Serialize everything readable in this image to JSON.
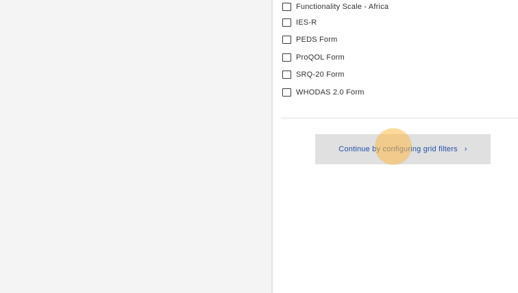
{
  "forms": {
    "items": [
      {
        "label": "Functionality Scale - Africa",
        "checked": false
      },
      {
        "label": "IES-R",
        "checked": false
      },
      {
        "label": "PEDS Form",
        "checked": false
      },
      {
        "label": "ProQOL Form",
        "checked": false
      },
      {
        "label": "SRQ-20 Form",
        "checked": false
      },
      {
        "label": "WHODAS 2.0 Form",
        "checked": false
      }
    ]
  },
  "actions": {
    "continue_label": "Continue by configuring grid filters",
    "continue_icon": "chevron-right-icon"
  },
  "colors": {
    "left_panel_bg": "#f4f4f4",
    "button_bg": "#e0e0e0",
    "button_text": "#1f4fa8",
    "click_indicator": "#ffb946"
  }
}
